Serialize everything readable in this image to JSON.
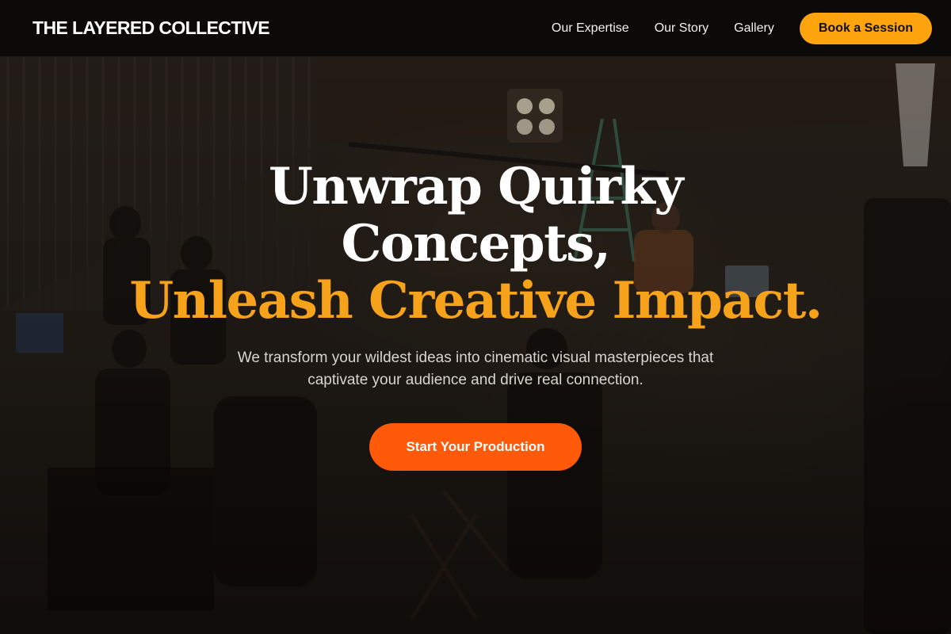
{
  "header": {
    "brand": "THE LAYERED COLLECTIVE",
    "nav": [
      {
        "label": "Our Expertise"
      },
      {
        "label": "Our Story"
      },
      {
        "label": "Gallery"
      }
    ],
    "cta_label": "Book a Session"
  },
  "hero": {
    "headline_line1": "Unwrap Quirky",
    "headline_line2": "Concepts,",
    "headline_accent": "Unleash Creative Impact.",
    "subtext": "We transform your wildest ideas into cinematic visual masterpieces that captivate your audience and drive real connection.",
    "cta_label": "Start Your Production"
  },
  "colors": {
    "accent_orange": "#f7a21b",
    "book_button": "#ffa30f",
    "primary_button": "#ff5a0a",
    "header_bg": "#080808"
  }
}
